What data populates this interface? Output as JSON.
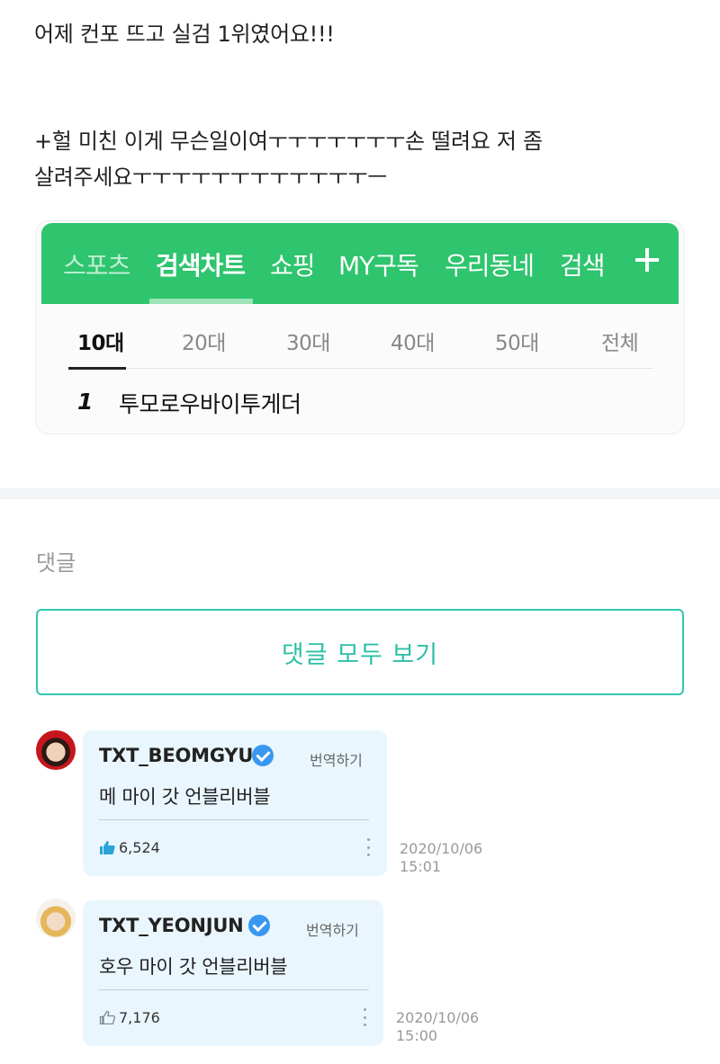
{
  "post": {
    "line1": "어제 컨포 뜨고 실검 1위였어요!!!",
    "line2": "+헐 미친 이게 무슨일이여ㅜㅜㅜㅜㅜㅜㅜ손 떨려요 저 좀",
    "line3": "살려주세요ㅜㅜㅜㅜㅜㅜㅜㅜㅜㅜㅜㅜㅡ"
  },
  "search_chart": {
    "tabs": [
      "스포츠",
      "검색차트",
      "쇼핑",
      "MY구독",
      "우리동네",
      "검색"
    ],
    "active_tab": "검색차트",
    "age_tabs": [
      "10대",
      "20대",
      "30대",
      "40대",
      "50대",
      "전체"
    ],
    "active_age": "10대",
    "rank": "1",
    "rank_name": "투모로우바이투게더",
    "accent_color": "#2fc46e"
  },
  "comments_section": {
    "title": "댓글",
    "view_all_label": "댓글 모두 보기",
    "accent_color": "#31c7b1"
  },
  "comments": [
    {
      "username": "TXT_BEOMGYU",
      "verified": true,
      "translate_label": "번역하기",
      "text": "메 마이 갓 언블리버블",
      "likes": "6,524",
      "liked": true,
      "date": "2020/10/06",
      "time": "15:01"
    },
    {
      "username": "TXT_YEONJUN",
      "verified": true,
      "translate_label": "번역하기",
      "text": "호우 마이 갓 언블리버블",
      "likes": "7,176",
      "liked": false,
      "date": "2020/10/06",
      "time": "15:00"
    }
  ]
}
